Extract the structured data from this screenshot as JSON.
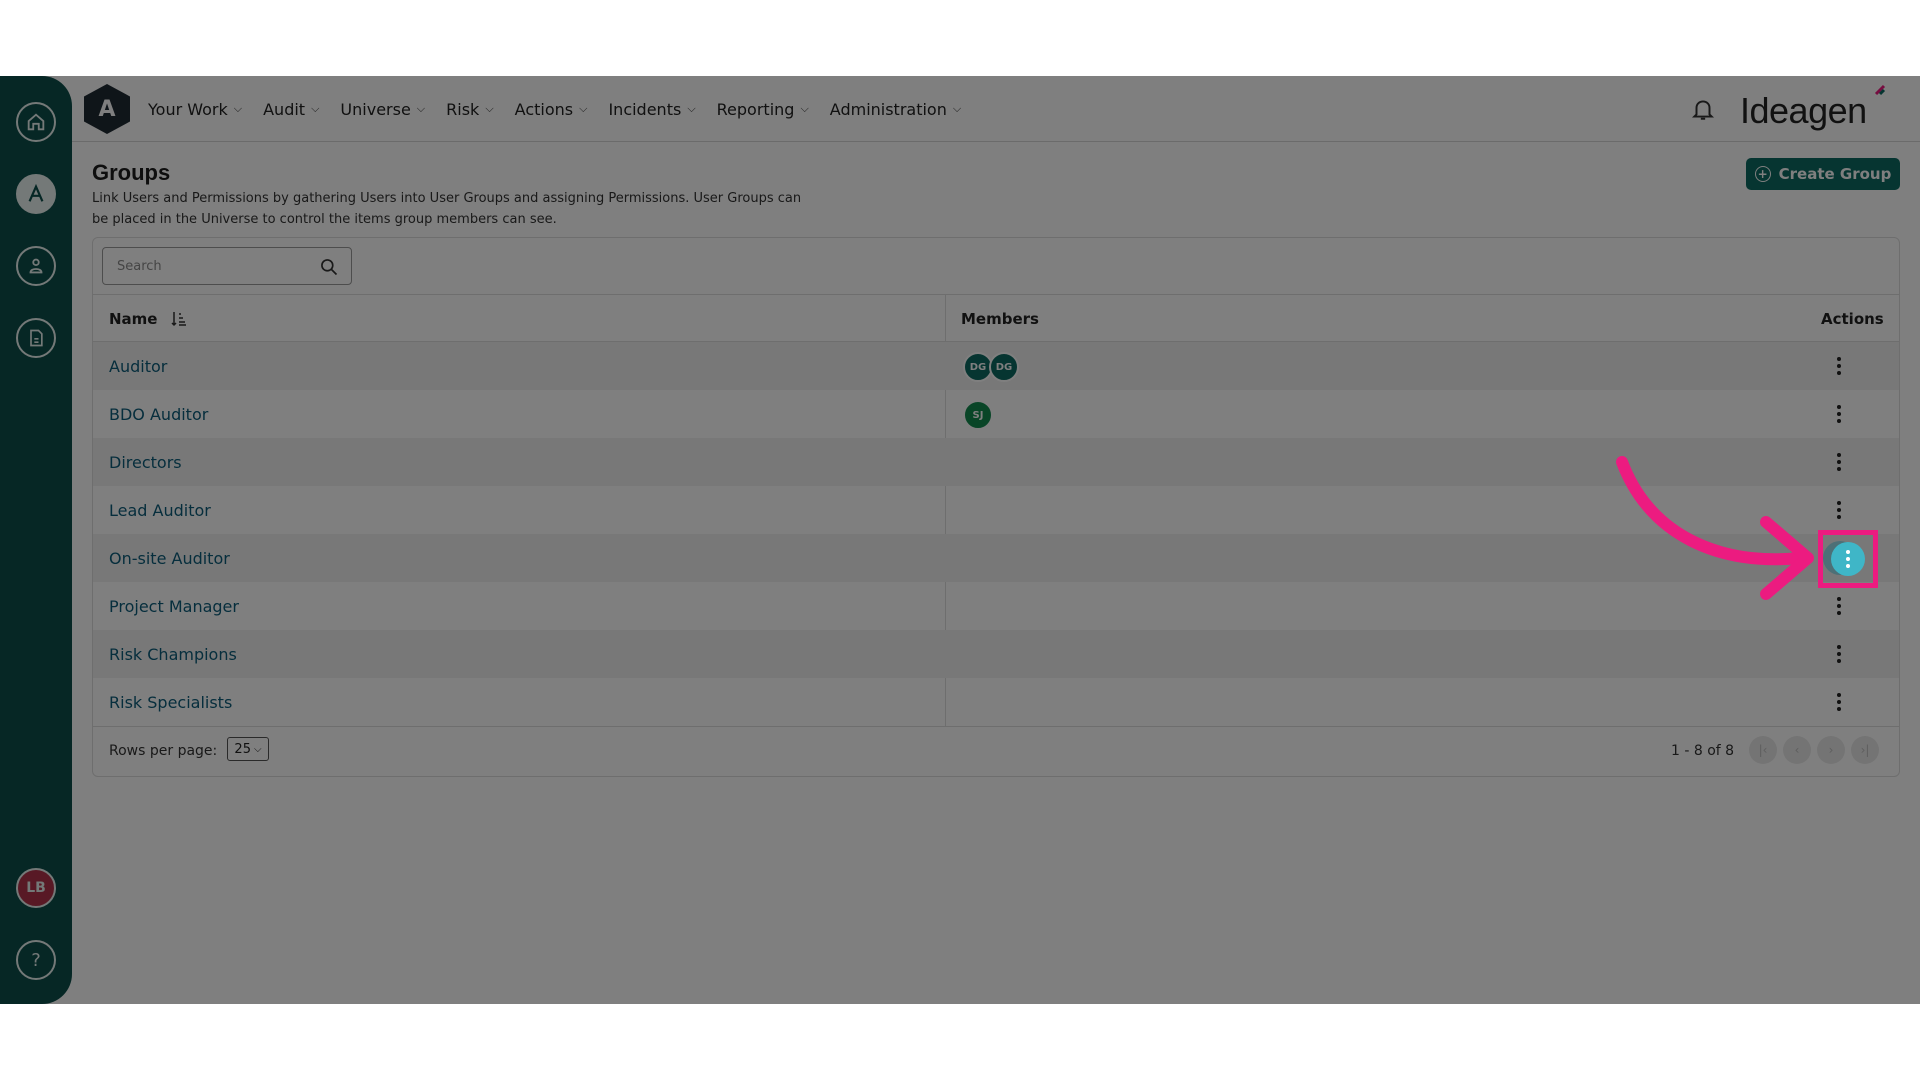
{
  "sidebar": {
    "avatar_initials": "LB",
    "help_label": "?"
  },
  "topbar": {
    "logo_letter": "A",
    "nav": [
      "Your Work",
      "Audit",
      "Universe",
      "Risk",
      "Actions",
      "Incidents",
      "Reporting",
      "Administration"
    ],
    "brand": "Ideagen"
  },
  "page": {
    "title": "Groups",
    "description": "Link Users and Permissions by gathering Users into User Groups and assigning Permissions. User Groups can be placed in the Universe to control the items group members can see.",
    "create_label": "Create Group"
  },
  "search": {
    "placeholder": "Search"
  },
  "table": {
    "col_name": "Name",
    "col_members": "Members",
    "col_actions": "Actions",
    "rows": [
      {
        "name": "Auditor",
        "members": [
          "DG",
          "DG"
        ]
      },
      {
        "name": "BDO Auditor",
        "members": [
          "SJ"
        ]
      },
      {
        "name": "Directors",
        "members": []
      },
      {
        "name": "Lead Auditor",
        "members": []
      },
      {
        "name": "On-site Auditor",
        "members": []
      },
      {
        "name": "Project Manager",
        "members": []
      },
      {
        "name": "Risk Champions",
        "members": []
      },
      {
        "name": "Risk Specialists",
        "members": []
      }
    ]
  },
  "footer": {
    "rows_per_page_label": "Rows per page:",
    "rows_per_page_value": "25",
    "range": "1 - 8 of 8"
  },
  "colors": {
    "sidebar": "#0d4f4a",
    "primary": "#0d6b62",
    "link": "#0d5d7a",
    "highlight": "#ec1b80"
  }
}
